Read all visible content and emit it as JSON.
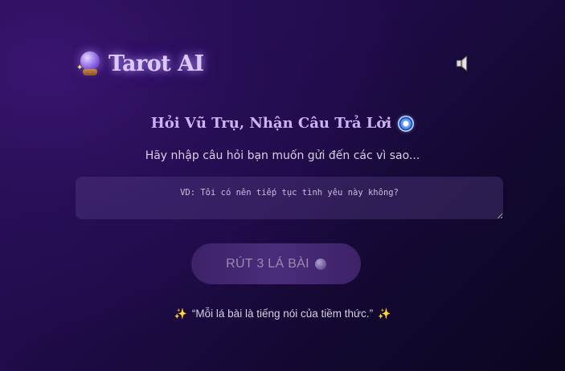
{
  "header": {
    "logo_title": "Tarot AI",
    "logo_icon": "crystal-ball-icon",
    "sound_icon": "speaker-muted-icon"
  },
  "main": {
    "heading": "Hỏi Vũ Trụ, Nhận Câu Trả Lời",
    "heading_icon": "evil-eye-icon",
    "subtitle": "Hãy nhập câu hỏi bạn muốn gửi đến các vì sao...",
    "question_input": {
      "placeholder": "VD: Tôi có nên tiếp tục tình yêu này không?",
      "value": ""
    },
    "draw_button_label": "RÚT 3 LÁ BÀI",
    "quote": "“Mỗi lá bài là tiếng nói của tiềm thức.”"
  },
  "colors": {
    "background_dark": "#12082e",
    "background_purple": "#3a1570",
    "accent_lavender": "#cdb2f5",
    "button_bg": "#4a2c7c",
    "sparkle": "#ffd95a"
  }
}
